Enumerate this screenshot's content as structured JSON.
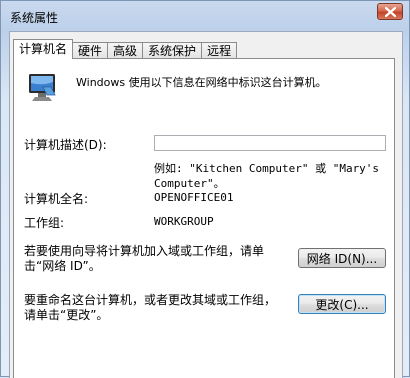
{
  "window": {
    "title": "系统属性"
  },
  "tabs": [
    {
      "label": "计算机名"
    },
    {
      "label": "硬件"
    },
    {
      "label": "高级"
    },
    {
      "label": "系统保护"
    },
    {
      "label": "远程"
    }
  ],
  "panel": {
    "intro": "Windows 使用以下信息在网络中标识这台计算机。",
    "description_label": "计算机描述(D):",
    "description_value": "",
    "example_line1": "例如: \"Kitchen Computer\" 或 \"Mary's",
    "example_line2": "Computer\"。",
    "fullname_label": "计算机全名:",
    "fullname_value": "OPENOFFICE01",
    "workgroup_label": "工作组:",
    "workgroup_value": "WORKGROUP",
    "join_text_line1": "若要使用向导将计算机加入域或工作组，请单",
    "join_text_line2": "击“网络 ID”。",
    "network_id_button": "网络 ID(N)...",
    "rename_text_line1": "要重命名这台计算机，或者更改其域或工作组，",
    "rename_text_line2": "请单击“更改”。",
    "change_button": "更改(C)..."
  }
}
